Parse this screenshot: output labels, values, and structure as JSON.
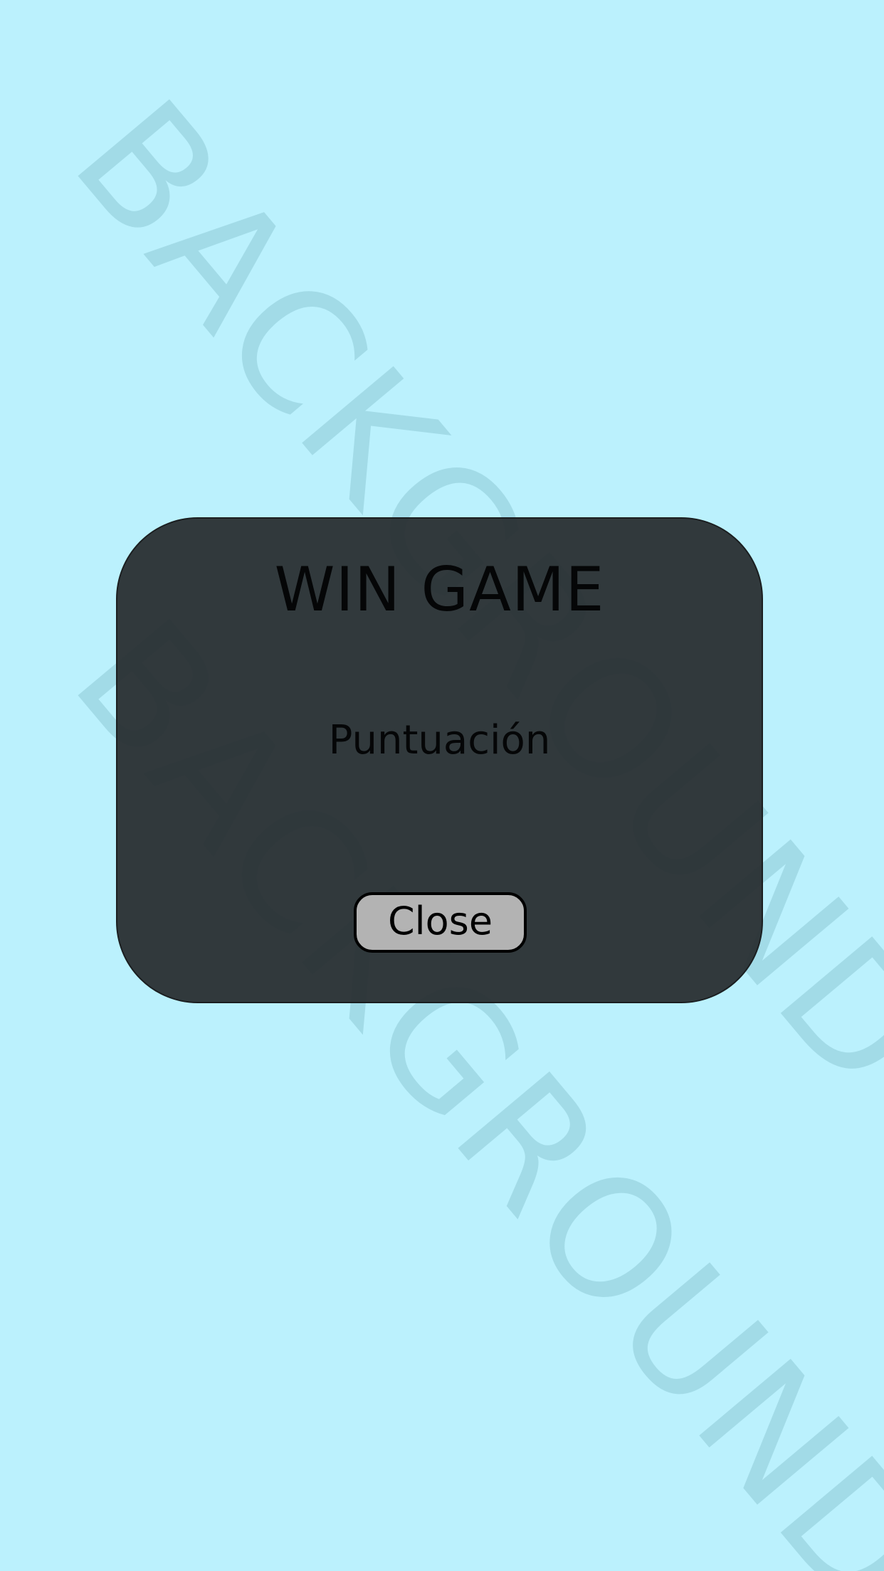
{
  "background": {
    "watermark_text": "BACKGROUND",
    "color": "#bbf1fd",
    "watermark_color": "#8ec9d6"
  },
  "dialog": {
    "title": "WIN GAME",
    "score_label": "Puntuación",
    "close_label": "Close",
    "panel_color": "#2b3134",
    "button_color": "#b3b3b3"
  }
}
